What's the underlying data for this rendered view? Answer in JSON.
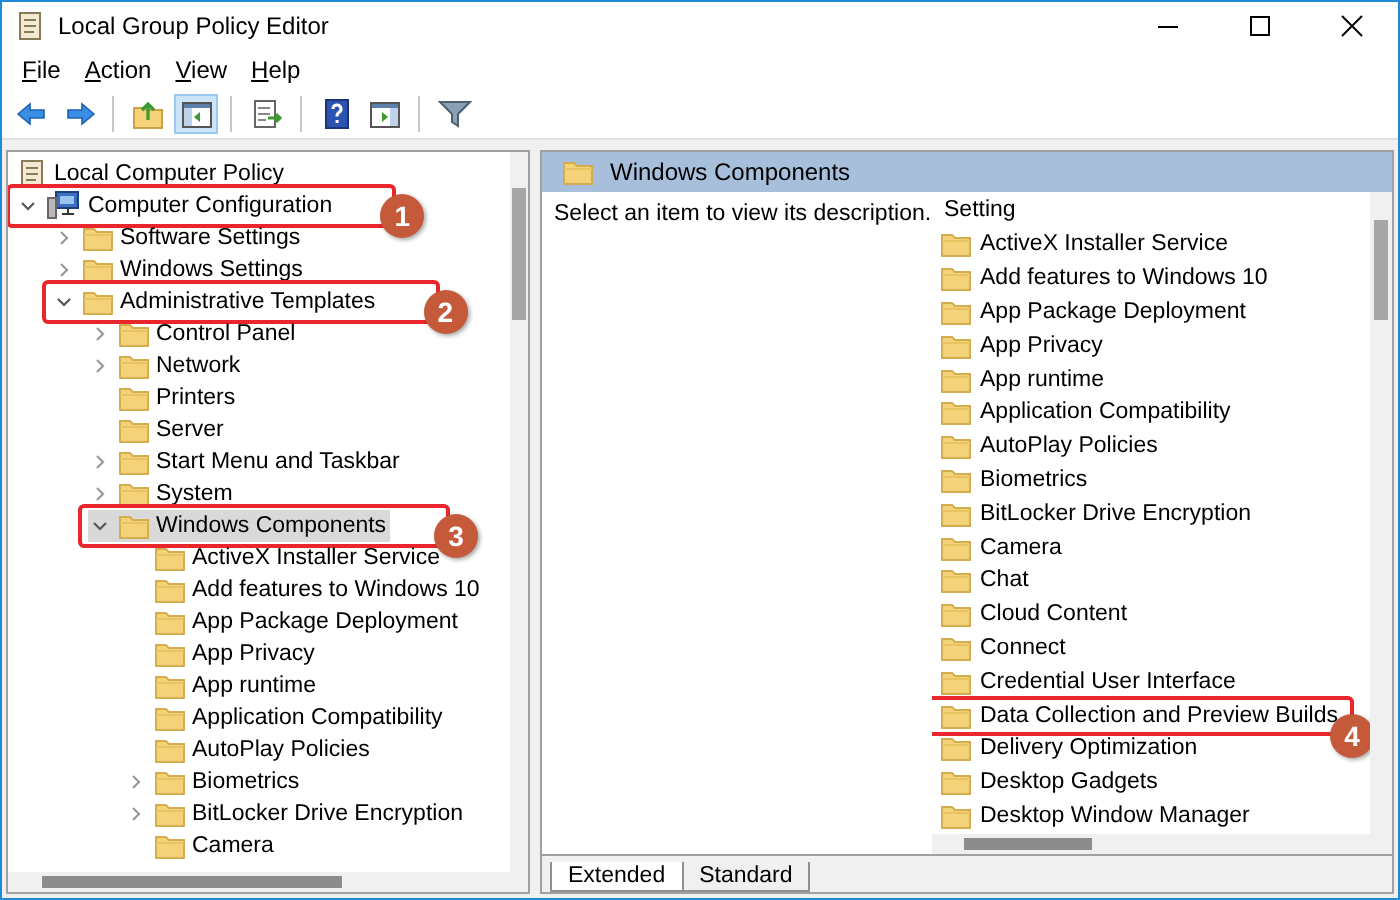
{
  "window": {
    "title": "Local Group Policy Editor"
  },
  "menu": [
    {
      "label": "File"
    },
    {
      "label": "Action"
    },
    {
      "label": "View"
    },
    {
      "label": "Help"
    }
  ],
  "toolbar": [
    {
      "kind": "back",
      "pressed": false
    },
    {
      "kind": "forward",
      "pressed": false
    },
    {
      "kind": "sep"
    },
    {
      "kind": "up",
      "pressed": false
    },
    {
      "kind": "tree",
      "pressed": true
    },
    {
      "kind": "sep"
    },
    {
      "kind": "export",
      "pressed": false
    },
    {
      "kind": "sep"
    },
    {
      "kind": "help",
      "pressed": false
    },
    {
      "kind": "pane",
      "pressed": false
    },
    {
      "kind": "sep"
    },
    {
      "kind": "filter",
      "pressed": false
    }
  ],
  "tree": [
    {
      "label": "Local Computer Policy",
      "kind": "policy",
      "selected": false,
      "children": [
        {
          "label": "Computer Configuration",
          "kind": "computer",
          "selected": false,
          "expanded": true,
          "callout": "1",
          "children": [
            {
              "label": "Software Settings",
              "kind": "folder",
              "selected": false,
              "expanded": false
            },
            {
              "label": "Windows Settings",
              "kind": "folder",
              "selected": false,
              "expanded": false
            },
            {
              "label": "Administrative Templates",
              "kind": "folder",
              "selected": false,
              "expanded": true,
              "callout": "2",
              "children": [
                {
                  "label": "Control Panel",
                  "kind": "folder",
                  "selected": false,
                  "expanded": false
                },
                {
                  "label": "Network",
                  "kind": "folder",
                  "selected": false,
                  "expanded": false
                },
                {
                  "label": "Printers",
                  "kind": "folder",
                  "selected": false
                },
                {
                  "label": "Server",
                  "kind": "folder",
                  "selected": false
                },
                {
                  "label": "Start Menu and Taskbar",
                  "kind": "folder",
                  "selected": false,
                  "expanded": false
                },
                {
                  "label": "System",
                  "kind": "folder",
                  "selected": false,
                  "expanded": false
                },
                {
                  "label": "Windows Components",
                  "kind": "folder",
                  "selected": true,
                  "expanded": true,
                  "callout": "3",
                  "children": [
                    {
                      "label": "ActiveX Installer Service",
                      "kind": "folder",
                      "selected": false
                    },
                    {
                      "label": "Add features to Windows 10",
                      "kind": "folder",
                      "selected": false
                    },
                    {
                      "label": "App Package Deployment",
                      "kind": "folder",
                      "selected": false
                    },
                    {
                      "label": "App Privacy",
                      "kind": "folder",
                      "selected": false
                    },
                    {
                      "label": "App runtime",
                      "kind": "folder",
                      "selected": false
                    },
                    {
                      "label": "Application Compatibility",
                      "kind": "folder",
                      "selected": false
                    },
                    {
                      "label": "AutoPlay Policies",
                      "kind": "folder",
                      "selected": false
                    },
                    {
                      "label": "Biometrics",
                      "kind": "folder",
                      "selected": false,
                      "expanded": false
                    },
                    {
                      "label": "BitLocker Drive Encryption",
                      "kind": "folder",
                      "selected": false,
                      "expanded": false
                    },
                    {
                      "label": "Camera",
                      "kind": "folder",
                      "selected": false
                    }
                  ]
                }
              ]
            }
          ]
        }
      ]
    }
  ],
  "details": {
    "title": "Windows Components",
    "description": "Select an item to view its description.",
    "column": "Setting",
    "items": [
      {
        "label": "ActiveX Installer Service"
      },
      {
        "label": "Add features to Windows 10"
      },
      {
        "label": "App Package Deployment"
      },
      {
        "label": "App Privacy"
      },
      {
        "label": "App runtime"
      },
      {
        "label": "Application Compatibility"
      },
      {
        "label": "AutoPlay Policies"
      },
      {
        "label": "Biometrics"
      },
      {
        "label": "BitLocker Drive Encryption"
      },
      {
        "label": "Camera"
      },
      {
        "label": "Chat"
      },
      {
        "label": "Cloud Content"
      },
      {
        "label": "Connect"
      },
      {
        "label": "Credential User Interface"
      },
      {
        "label": "Data Collection and Preview Builds",
        "callout": "4"
      },
      {
        "label": "Delivery Optimization"
      },
      {
        "label": "Desktop Gadgets"
      },
      {
        "label": "Desktop Window Manager"
      }
    ]
  },
  "tabs": [
    {
      "label": "Extended",
      "selected": true
    },
    {
      "label": "Standard",
      "selected": false
    }
  ]
}
